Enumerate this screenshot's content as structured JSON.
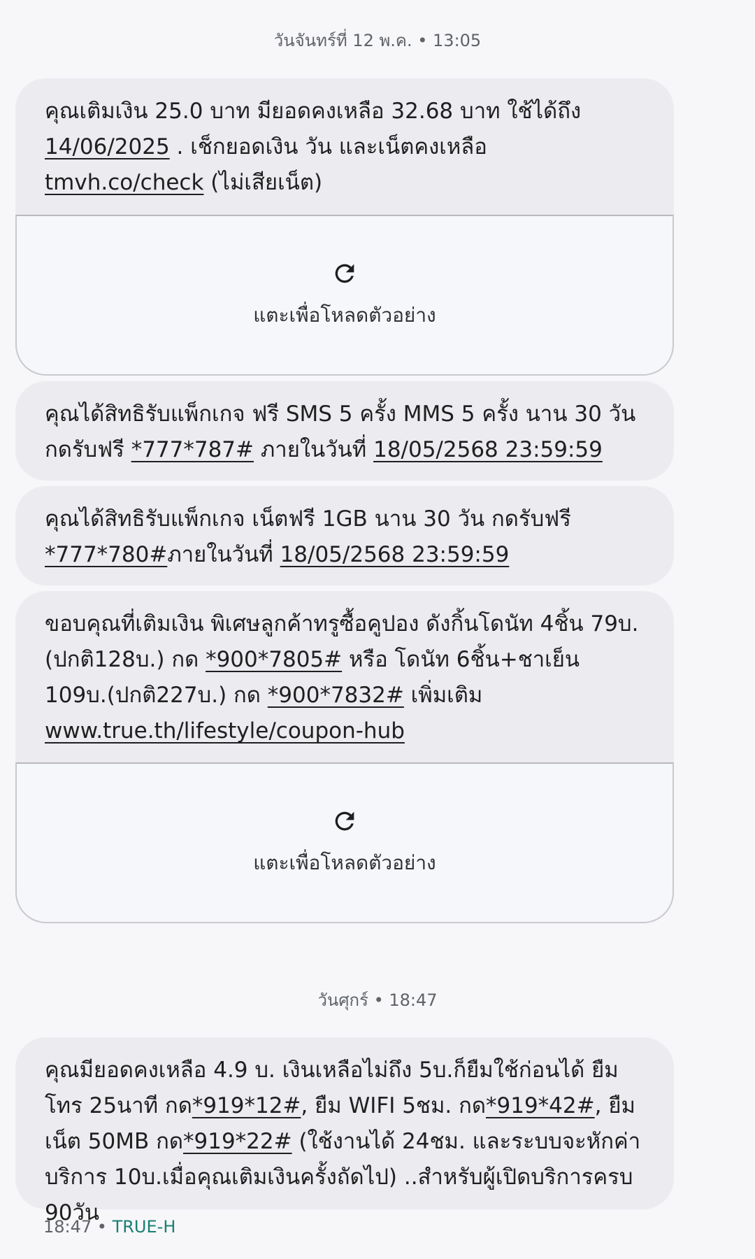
{
  "thread": {
    "timestamp_1": "วันจันทร์ที่ 12 พ.ค. • 13:05",
    "timestamp_2": "วันศุกร์ • 18:47",
    "footer_time": "18:47",
    "footer_sep": " • ",
    "footer_sender": "TRUE-H"
  },
  "messages": [
    {
      "parts": [
        "คุณเติมเงิน 25.0 บาท มียอดคงเหลือ 32.68 บาท ใช้ได้ถึง ",
        "14/06/2025",
        " . เช็กยอดเงิน วัน และเน็ตคงเหลือ ",
        "tmvh.co/check",
        " (ไม่เสียเน็ต)"
      ]
    },
    {
      "parts": [
        "คุณได้สิทธิรับแพ็กเกจ ฟรี SMS 5 ครั้ง MMS 5 ครั้ง นาน 30 วัน กดรับฟรี ",
        "*777*787#",
        " ภายในวันที่ ",
        "18/05/2568 23:59:59"
      ]
    },
    {
      "parts": [
        "คุณได้สิทธิรับแพ็กเกจ เน็ตฟรี 1GB นาน 30 วัน กดรับฟรี ",
        "*777*780#",
        "ภายในวันที่ ",
        "18/05/2568 23:59:59"
      ]
    },
    {
      "parts": [
        "ขอบคุณที่เติมเงิน พิเศษลูกค้าทรูซื้อคูปอง ดังกิ้นโดนัท 4ชิ้น 79บ.(ปกติ128บ.) กด ",
        "*900*7805#",
        " หรือ โดนัท 6ชิ้น+ชาเย็น 109บ.(ปกติ227บ.) กด ",
        "*900*7832#",
        " เพิ่มเติม ",
        "www.true.th/lifestyle/coupon-hub"
      ]
    },
    {
      "parts": [
        "คุณมียอดคงเหลือ 4.9 บ. เงินเหลือไม่ถึง 5บ.ก็ยืมใช้ก่อนได้ ยืมโทร 25นาที กด",
        "*919*12#",
        ", ยืม WIFI 5ชม. กด",
        "*919*42#",
        ", ยืมเน็ต 50MB กด",
        "*919*22#",
        " (ใช้งานได้ 24ชม. และระบบจะหักค่าบริการ 10บ.เมื่อคุณเติมเงินครั้งถัดไป) ..สำหรับผู้เปิดบริการครบ 90วัน"
      ]
    }
  ],
  "preview": {
    "tap_to_load": "แตะเพื่อโหลดตัวอย่าง",
    "icon": "refresh-icon"
  }
}
